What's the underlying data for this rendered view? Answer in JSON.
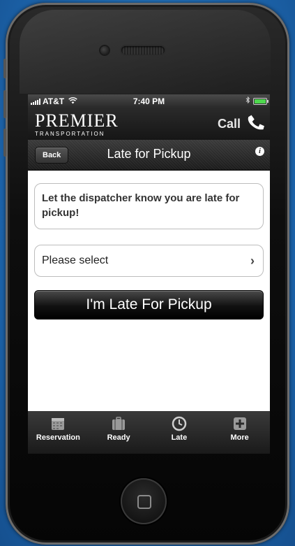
{
  "status_bar": {
    "carrier": "AT&T",
    "time": "7:40 PM"
  },
  "brand": {
    "name": "PREMIER",
    "tagline": "TRANSPORTATION",
    "call_label": "Call"
  },
  "nav": {
    "back_label": "Back",
    "title": "Late for Pickup"
  },
  "content": {
    "message": "Let the dispatcher know you are late for pickup!",
    "select_value": "Please select",
    "submit_label": "I'm Late For Pickup"
  },
  "tabs": [
    {
      "label": "Reservation",
      "icon": "calendar-icon"
    },
    {
      "label": "Ready",
      "icon": "luggage-icon"
    },
    {
      "label": "Late",
      "icon": "clock-icon"
    },
    {
      "label": "More",
      "icon": "plus-icon"
    }
  ],
  "colors": {
    "background": "#1f6bb5",
    "bar_dark": "#1c1c1c",
    "battery": "#4ed84e"
  }
}
